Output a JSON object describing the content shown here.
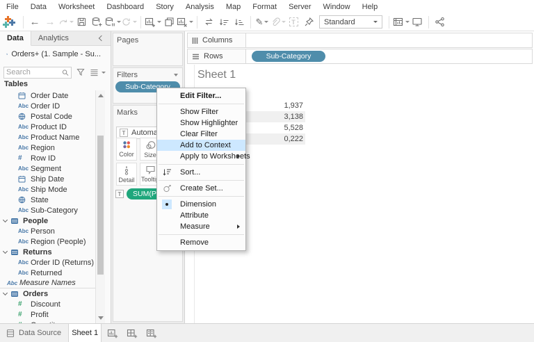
{
  "menu_bar": {
    "items": [
      "File",
      "Data",
      "Worksheet",
      "Dashboard",
      "Story",
      "Analysis",
      "Map",
      "Format",
      "Server",
      "Window",
      "Help"
    ]
  },
  "toolbar": {
    "view_mode": "Standard"
  },
  "icons": {
    "abc": "Abc",
    "hash": "#",
    "text": "T"
  },
  "data_pane": {
    "tab_data": "Data",
    "tab_analytics": "Analytics",
    "datasource_label": "Orders+ (1. Sample - Su...",
    "search_placeholder": "Search",
    "tables_header": "Tables",
    "fields": [
      {
        "label": "Order Date",
        "icon": "calendar"
      },
      {
        "label": "Order ID",
        "icon": "abc"
      },
      {
        "label": "Postal Code",
        "icon": "globe"
      },
      {
        "label": "Product ID",
        "icon": "abc"
      },
      {
        "label": "Product Name",
        "icon": "abc"
      },
      {
        "label": "Region",
        "icon": "abc"
      },
      {
        "label": "Row ID",
        "icon": "number-blue"
      },
      {
        "label": "Segment",
        "icon": "abc"
      },
      {
        "label": "Ship Date",
        "icon": "calendar"
      },
      {
        "label": "Ship Mode",
        "icon": "abc"
      },
      {
        "label": "State",
        "icon": "globe"
      },
      {
        "label": "Sub-Category",
        "icon": "abc"
      },
      {
        "label": "People",
        "icon": "table"
      },
      {
        "label": "Person",
        "icon": "abc"
      },
      {
        "label": "Region (People)",
        "icon": "abc"
      },
      {
        "label": "Returns",
        "icon": "table"
      },
      {
        "label": "Order ID (Returns)",
        "icon": "abc"
      },
      {
        "label": "Returned",
        "icon": "abc"
      },
      {
        "label": "Measure Names",
        "icon": "abc"
      },
      {
        "label": "Orders",
        "icon": "table"
      },
      {
        "label": "Discount",
        "icon": "number-green"
      },
      {
        "label": "Profit",
        "icon": "number-green"
      },
      {
        "label": "Quantity",
        "icon": "number-green"
      }
    ]
  },
  "cards": {
    "pages_title": "Pages",
    "filters_title": "Filters",
    "filter_pill": "Sub-Category",
    "marks_title": "Marks",
    "mark_type": "Automatic",
    "buttons": {
      "color": "Color",
      "size": "Size",
      "detail": "Detail",
      "tooltip": "Tooltip"
    },
    "marks_pill": "SUM(Pro"
  },
  "shelves": {
    "columns_label": "Columns",
    "rows_label": "Rows",
    "rows_pill": "Sub-Category"
  },
  "sheet": {
    "title": "Sheet 1",
    "values": [
      "1,937",
      "3,138",
      "5,528",
      "0,222"
    ]
  },
  "context_menu": {
    "items": [
      {
        "label": "Edit Filter..."
      },
      {
        "label": "Show Filter"
      },
      {
        "label": "Show Highlighter"
      },
      {
        "label": "Clear Filter"
      },
      {
        "label": "Add to Context"
      },
      {
        "label": "Apply to Worksheets"
      },
      {
        "label": "Sort..."
      },
      {
        "label": "Create Set..."
      },
      {
        "label": "Dimension"
      },
      {
        "label": "Attribute"
      },
      {
        "label": "Measure"
      },
      {
        "label": "Remove"
      }
    ]
  },
  "status_bar": {
    "data_source_label": "Data Source",
    "sheet_tab": "Sheet 1"
  },
  "colors": {
    "dimension_pill": "#4f8dab",
    "measure_pill": "#1fa77c",
    "menu_highlight": "#cde8ff",
    "field_icon_blue": "#4878a8",
    "measure_icon_green": "#3aa26d",
    "row_band": "#f0f0f0"
  }
}
